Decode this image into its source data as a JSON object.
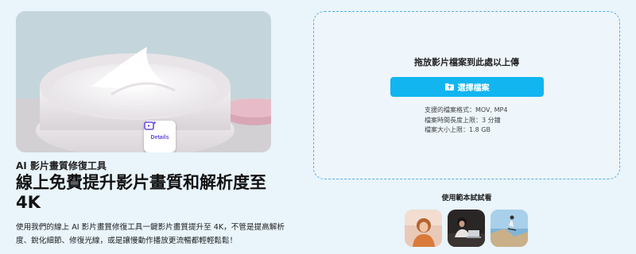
{
  "hero": {
    "badge_label": "Details",
    "badge_icon": "sparkle-video-icon"
  },
  "intro": {
    "subtitle": "AI 影片畫質修復工具",
    "title": "線上免費提升影片畫質和解析度至 4K",
    "description": "使用我們的線上 AI 影片畫質修復工具一鍵影片畫質提升至 4K，不管是提高解析度、銳化細節、修復光線，或是讓慢動作播放更流暢都輕輕鬆鬆！"
  },
  "upload": {
    "drop_text": "拖放影片檔案到此處以上傳",
    "button_label": "選擇檔案",
    "button_icon": "folder-icon",
    "formats": "支援的檔案格式：MOV, MP4",
    "duration_limit": "檔案時間長度上限：3 分鐘",
    "size_limit": "檔案大小上限：1.8 GB"
  },
  "samples": {
    "title": "使用範本試試看",
    "items": [
      "sample-woman-photo",
      "sample-person-laptop",
      "sample-skateboarder"
    ]
  },
  "colors": {
    "accent": "#12b5f0",
    "background": "#e9f4fb",
    "dashed_border": "#5aaee0",
    "badge_text": "#6b4de0"
  }
}
